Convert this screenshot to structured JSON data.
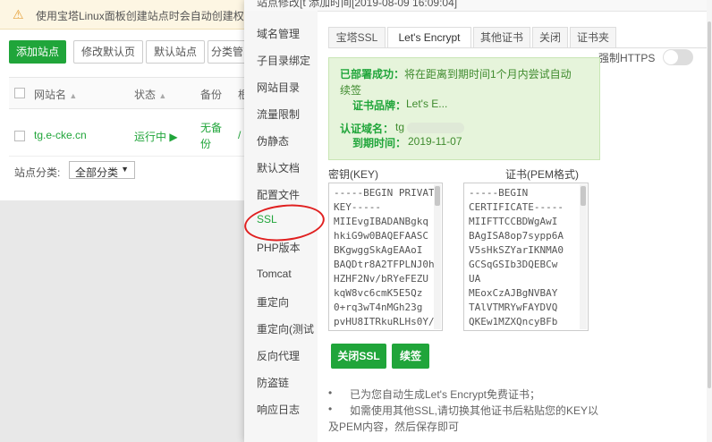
{
  "background": {
    "notice": "使用宝塔Linux面板创建站点时会自动创建权",
    "buttons": {
      "add_site": "添加站点",
      "edit_default_page": "修改默认页",
      "default_site": "默认站点",
      "category": "分类管"
    },
    "table": {
      "headers": [
        "网站名",
        "状态",
        "备份",
        "根"
      ],
      "rows": [
        {
          "site": "tg.e-cke.cn",
          "status": "运行中",
          "backup": [
            "无备",
            "份"
          ],
          "root": "/"
        }
      ]
    },
    "category_filter": {
      "label": "站点分类:",
      "value": "全部分类"
    },
    "colors": {
      "accent": "#20a53a"
    }
  },
  "modal": {
    "title": "站点修改[t          添加时间[2019-08-09 16:09:04]",
    "side_menu": [
      "域名管理",
      "子目录绑定",
      "网站目录",
      "流量限制",
      "伪静态",
      "默认文档",
      "配置文件",
      "SSL",
      "PHP版本",
      "Tomcat",
      "重定向",
      "重定向(测试",
      "反向代理",
      "防盗链",
      "响应日志"
    ],
    "active_item": "SSL",
    "tabs": [
      "宝塔SSL",
      "Let's Encrypt",
      "其他证书",
      "关闭",
      "证书夹"
    ],
    "active_tab": "Let's Encrypt",
    "force_https_label": "强制HTTPS",
    "force_https_enabled": false,
    "status": {
      "deployed_label": "已部署成功：",
      "deployed_text_1": "将在距离到期时间1个月内尝试自动",
      "deployed_text_2": "续签",
      "brand_label": "证书品牌：",
      "brand_value": "Let's E...",
      "domain_label": "认证域名：",
      "domain_value": "tg",
      "expiry_label": "到期时间：",
      "expiry_value": "2019-11-07"
    },
    "key_label": "密钥(KEY)",
    "cert_label": "证书(PEM格式)",
    "key_text": "-----BEGIN PRIVATE\nKEY-----\nMIIEvgIBADANBgkq\nhkiG9w0BAQEFAASC\nBKgwggSkAgEAAoI\nBAQDtr8A2TFPLNJ0h\nHZHF2Nv/bRYeFEZU\nkqW8vc6cmK5E5Qz\n0+rq3wT4nMGh23g\npvHU8ITRkuRLHs0Y/",
    "cert_text": "-----BEGIN\nCERTIFICATE-----\nMIIFTTCCBDWgAwI\nBAgISA8op7sypp6A\nV5sHkSZYarIKNMA0\nGCSqGSIb3DQEBCw\nUA\nMEoxCzAJBgNVBAY\nTAlVTMRYwFAYDVQ\nQKEw1MZXQncyBFb",
    "close_ssl_button": "关闭SSL",
    "renew_button": "续签",
    "tips": [
      "已为您自动生成Let's Encrypt免费证书；",
      "如需使用其他SSL,请切换其他证书后粘贴您的KEY以",
      "及PEM内容，然后保存即可"
    ]
  }
}
